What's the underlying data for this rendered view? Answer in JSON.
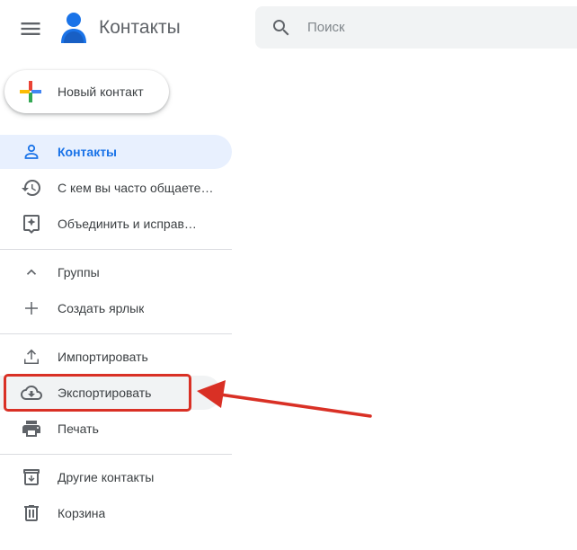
{
  "header": {
    "title": "Контакты",
    "menu_icon": "hamburger-menu-icon",
    "logo_icon": "contacts-logo-icon"
  },
  "search": {
    "placeholder": "Поиск",
    "value": ""
  },
  "create_button": {
    "label": "Новый контакт",
    "icon": "multicolor-plus-icon"
  },
  "nav": {
    "primary": [
      {
        "label": "Контакты",
        "icon": "person-icon",
        "active": true
      },
      {
        "label": "С кем вы часто общаете…",
        "icon": "history-icon"
      },
      {
        "label": "Объединить и исправ…",
        "icon": "merge-fix-icon"
      }
    ],
    "groups": {
      "header": "Группы",
      "header_icon": "chevron-up-icon",
      "create_label": "Создать ярлык",
      "create_icon": "plus-icon"
    },
    "actions": [
      {
        "label": "Импортировать",
        "icon": "upload-icon"
      },
      {
        "label": "Экспортировать",
        "icon": "cloud-download-icon",
        "highlighted": true
      },
      {
        "label": "Печать",
        "icon": "printer-icon"
      }
    ],
    "other": [
      {
        "label": "Другие контакты",
        "icon": "archive-icon"
      },
      {
        "label": "Корзина",
        "icon": "trash-icon"
      }
    ]
  },
  "colors": {
    "accent": "#1a73e8",
    "annotation": "#d93025",
    "active_bg": "#e8f0fe",
    "icon_gray": "#5f6368"
  }
}
